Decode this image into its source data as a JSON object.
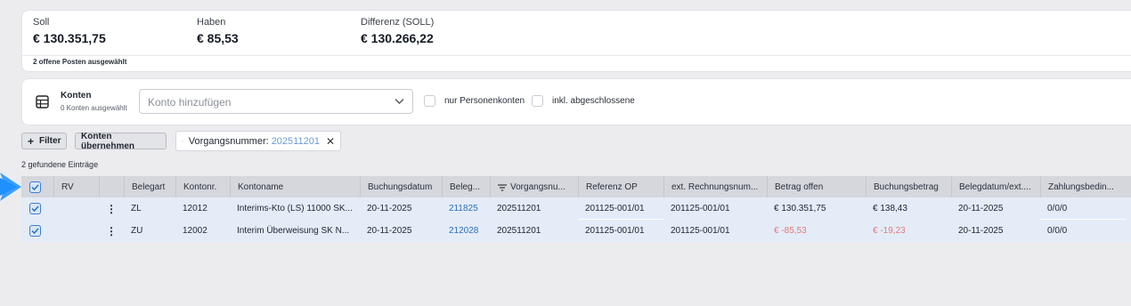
{
  "summary": {
    "soll_label": "Soll",
    "soll_value": "€ 130.351,75",
    "haben_label": "Haben",
    "haben_value": "€ 85,53",
    "diff_label": "Differenz (SOLL)",
    "diff_value": "€ 130.266,22",
    "footer": "2 offene Posten ausgewählt"
  },
  "accounts": {
    "title": "Konten",
    "subtitle": "0 Konten ausgewählt",
    "select_placeholder": "Konto hinzufügen",
    "only_persons_label": "nur Personenkonten",
    "include_closed_label": "inkl. abgeschlossene"
  },
  "toolbar": {
    "filter_label": "Filter",
    "apply_accounts_label": "Konten übernehmen",
    "chip_key": "Vorgangsnummer:",
    "chip_value": "202511201",
    "found_text": "2 gefundene Einträge"
  },
  "table": {
    "headers": {
      "rv": "RV",
      "belegart": "Belegart",
      "kontonr": "Kontonr.",
      "kontoname": "Kontoname",
      "buchungsdatum": "Buchungsdatum",
      "beleg": "Beleg...",
      "vorgangsnr": "Vorgangsnu...",
      "referenz": "Referenz OP",
      "ext_rechnung": "ext. Rechnungsnum...",
      "betrag_offen": "Betrag offen",
      "buchungsbetrag": "Buchungsbetrag",
      "belegdatum": "Belegdatum/ext....",
      "zahlungsbed": "Zahlungsbedin..."
    },
    "rows": [
      {
        "belegart": "ZL",
        "kontonr": "12012",
        "kontoname": "Interims-Kto (LS) 11000 SK...",
        "buchungsdatum": "20-11-2025",
        "beleg": "211825",
        "vorgangsnr": "202511201",
        "referenz": "201125-001/01",
        "ext_rechnung": "201125-001/01",
        "betrag_offen": "€ 130.351,75",
        "buchungsbetrag": "€ 138,43",
        "belegdatum": "20-11-2025",
        "zahlungsbed": "0/0/0"
      },
      {
        "belegart": "ZU",
        "kontonr": "12002",
        "kontoname": "Interim Überweisung SK N...",
        "buchungsdatum": "20-11-2025",
        "beleg": "212028",
        "vorgangsnr": "202511201",
        "referenz": "201125-001/01",
        "ext_rechnung": "201125-001/01",
        "betrag_offen": "€ -85,53",
        "buchungsbetrag": "€ -19,23",
        "belegdatum": "20-11-2025",
        "zahlungsbed": "0/0/0"
      }
    ]
  },
  "colors": {
    "link": "#2d6fb8",
    "negative": "#e07a7a",
    "selected_row": "#e4ecf7",
    "header_bg": "#d5d7dd",
    "pointer": "#1e90ff"
  }
}
